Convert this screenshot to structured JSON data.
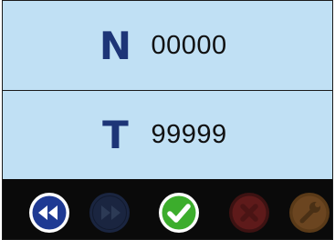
{
  "fields": [
    {
      "letter": "N",
      "value": "00000"
    },
    {
      "letter": "T",
      "value": "99999"
    }
  ],
  "toolbar": {
    "buttons": [
      {
        "icon": "rewind-icon",
        "state": "enabled",
        "color": "#1f3a93"
      },
      {
        "icon": "fast-forward-icon",
        "state": "disabled",
        "color": "#1a2540"
      },
      {
        "icon": "check-icon",
        "state": "enabled",
        "color": "#3cad2c"
      },
      {
        "icon": "close-icon",
        "state": "disabled",
        "color": "#5e1a1a"
      },
      {
        "icon": "wrench-icon",
        "state": "disabled",
        "color": "#5a3a18"
      }
    ]
  },
  "colors": {
    "panel_background": "#c0e0f4",
    "letter_color": "#1d3577",
    "toolbar_background": "#0a0a0a"
  }
}
